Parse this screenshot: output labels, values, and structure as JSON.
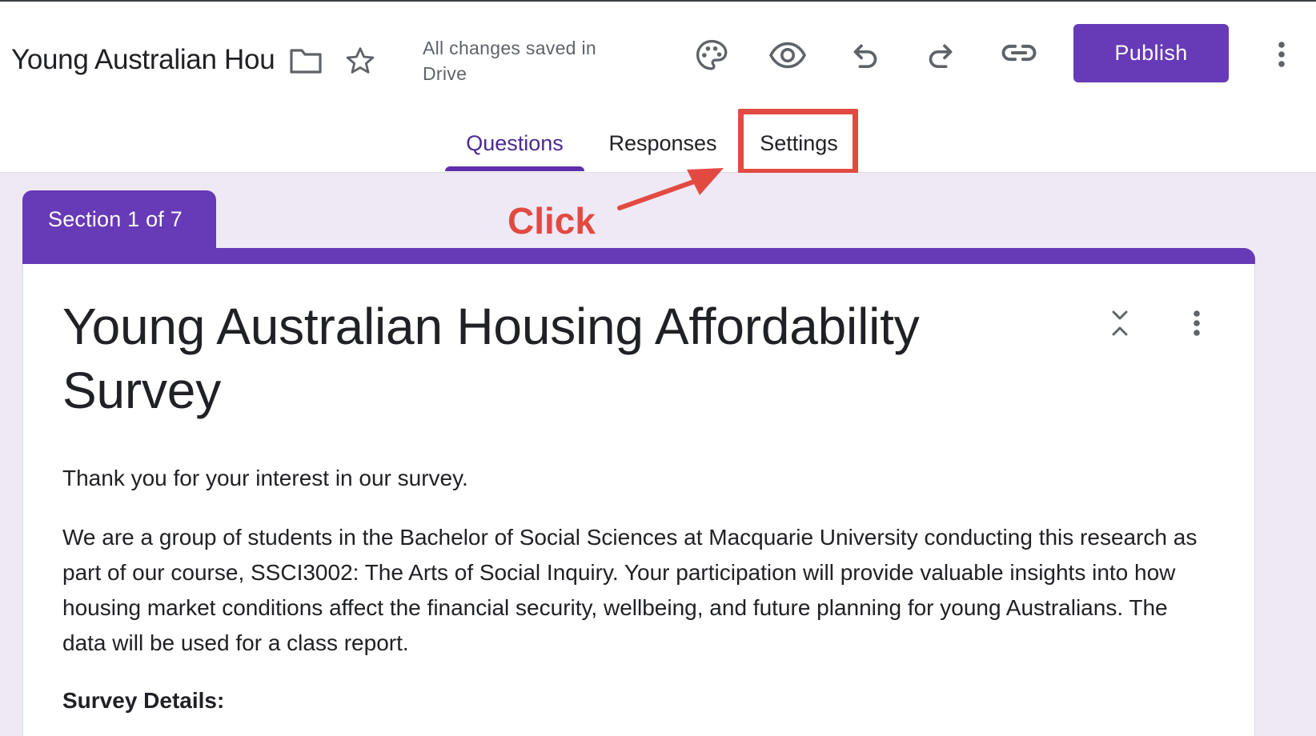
{
  "header": {
    "doc_title": "Young Australian Hou",
    "save_status_line1": "All changes saved in",
    "save_status_line2": "Drive",
    "publish_label": "Publish"
  },
  "icons": {
    "folder": "folder-icon",
    "star": "star-icon",
    "palette": "palette-icon",
    "preview": "eye-icon",
    "undo": "undo-icon",
    "redo": "redo-icon",
    "link": "link-icon",
    "more": "more-vert-icon"
  },
  "tabs": [
    {
      "label": "Questions",
      "active": true
    },
    {
      "label": "Responses",
      "active": false
    },
    {
      "label": "Settings",
      "active": false
    }
  ],
  "annotation": {
    "label": "Click",
    "color": "#e24a41"
  },
  "section": {
    "label": "Section 1 of 7"
  },
  "form": {
    "title": "Young Australian Housing Affordability Survey",
    "paragraph1": "Thank you for your interest in our survey.",
    "paragraph2": "We are a group of students in the Bachelor of Social Sciences at Macquarie University conducting this research as part of our course, SSCI3002: The Arts of Social Inquiry. Your participation will provide valuable insights into how housing market conditions affect the financial security, wellbeing, and future planning for young Australians. The data will be used for a class report.",
    "details_heading": "Survey Details:"
  },
  "colors": {
    "accent": "#673ab7",
    "active_tab_text": "#4a2a91",
    "background": "#efe9f6",
    "highlight": "#e24a41"
  }
}
